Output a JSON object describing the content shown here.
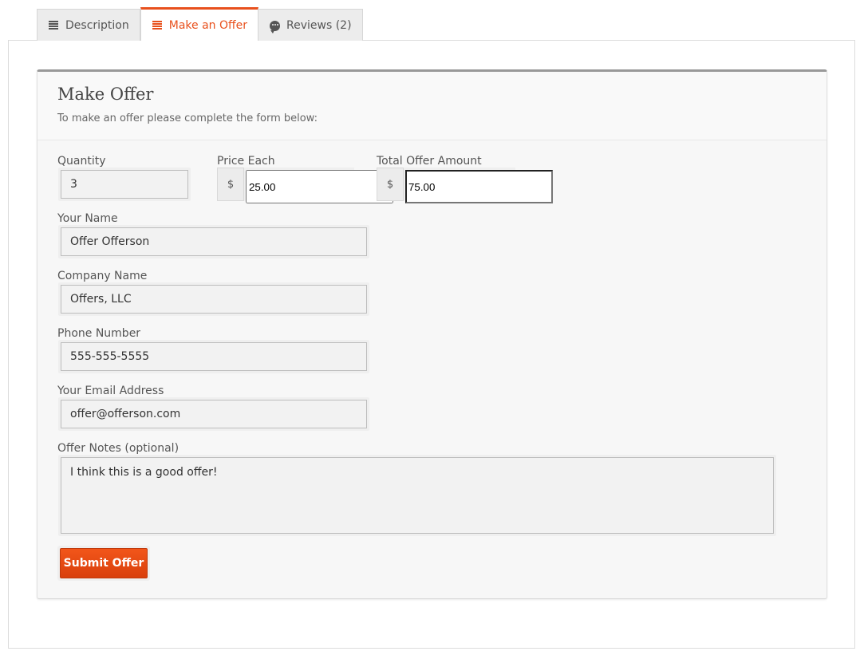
{
  "tabs": [
    {
      "label": "Description",
      "icon": "list-icon",
      "active": false
    },
    {
      "label": "Make an Offer",
      "icon": "list-icon",
      "active": true
    },
    {
      "label": "Reviews (2)",
      "icon": "chat-bubble-icon",
      "active": false
    }
  ],
  "form": {
    "title": "Make Offer",
    "subtitle": "To make an offer please complete the form below:",
    "quantity": {
      "label": "Quantity",
      "value": "3"
    },
    "price_each": {
      "label": "Price Each",
      "currency": "$",
      "value": "25.00"
    },
    "total": {
      "label": "Total Offer Amount",
      "currency": "$",
      "value": "75.00"
    },
    "name": {
      "label": "Your Name",
      "value": "Offer Offerson"
    },
    "company": {
      "label": "Company Name",
      "value": "Offers, LLC"
    },
    "phone": {
      "label": "Phone Number",
      "value": "555-555-5555"
    },
    "email": {
      "label": "Your Email Address",
      "value": "offer@offerson.com"
    },
    "notes": {
      "label": "Offer Notes (optional)",
      "value": "I think this is a good offer!"
    },
    "submit_label": "Submit Offer"
  },
  "colors": {
    "accent": "#e8501c",
    "button": "#e24a13"
  }
}
